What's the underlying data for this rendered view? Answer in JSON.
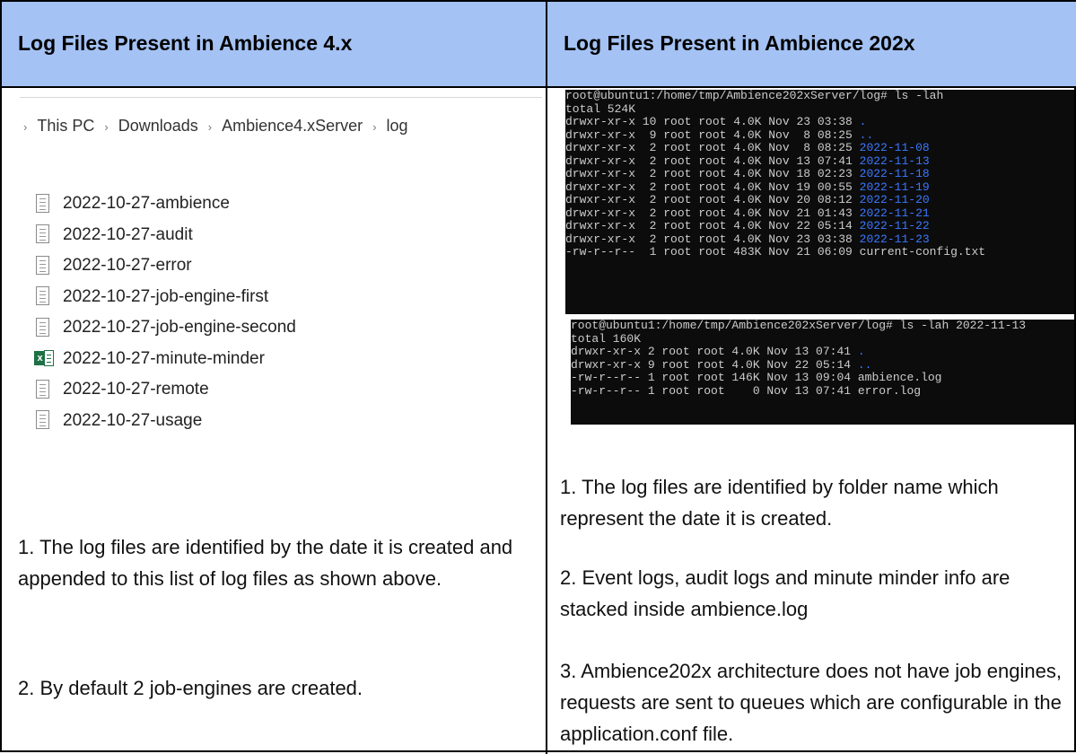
{
  "headers": {
    "left": "Log Files Present in Ambience 4.x",
    "right": "Log Files Present in Ambience 202x"
  },
  "breadcrumb": [
    "This PC",
    "Downloads",
    "Ambience4.xServer",
    "log"
  ],
  "files": [
    {
      "name": "2022-10-27-ambience",
      "icon": "text-file-icon"
    },
    {
      "name": "2022-10-27-audit",
      "icon": "text-file-icon"
    },
    {
      "name": "2022-10-27-error",
      "icon": "text-file-icon"
    },
    {
      "name": "2022-10-27-job-engine-first",
      "icon": "text-file-icon"
    },
    {
      "name": "2022-10-27-job-engine-second",
      "icon": "text-file-icon"
    },
    {
      "name": "2022-10-27-minute-minder",
      "icon": "excel-file-icon"
    },
    {
      "name": "2022-10-27-remote",
      "icon": "text-file-icon"
    },
    {
      "name": "2022-10-27-usage",
      "icon": "text-file-icon"
    }
  ],
  "left_notes": [
    "1. The log files are identified by the date it is created and appended to this list of log files as shown above.",
    "2. By default 2 job-engines are created."
  ],
  "terminal1": [
    {
      "text": "root@ubuntu1:/home/tmp/Ambience202xServer/log# ls -lah",
      "blue": ""
    },
    {
      "text": "total 524K",
      "blue": ""
    },
    {
      "text": "drwxr-xr-x 10 root root 4.0K Nov 23 03:38 ",
      "blue": "."
    },
    {
      "text": "drwxr-xr-x  9 root root 4.0K Nov  8 08:25 ",
      "blue": ".."
    },
    {
      "text": "drwxr-xr-x  2 root root 4.0K Nov  8 08:25 ",
      "blue": "2022-11-08"
    },
    {
      "text": "drwxr-xr-x  2 root root 4.0K Nov 13 07:41 ",
      "blue": "2022-11-13"
    },
    {
      "text": "drwxr-xr-x  2 root root 4.0K Nov 18 02:23 ",
      "blue": "2022-11-18"
    },
    {
      "text": "drwxr-xr-x  2 root root 4.0K Nov 19 00:55 ",
      "blue": "2022-11-19"
    },
    {
      "text": "drwxr-xr-x  2 root root 4.0K Nov 20 08:12 ",
      "blue": "2022-11-20"
    },
    {
      "text": "drwxr-xr-x  2 root root 4.0K Nov 21 01:43 ",
      "blue": "2022-11-21"
    },
    {
      "text": "drwxr-xr-x  2 root root 4.0K Nov 22 05:14 ",
      "blue": "2022-11-22"
    },
    {
      "text": "drwxr-xr-x  2 root root 4.0K Nov 23 03:38 ",
      "blue": "2022-11-23"
    },
    {
      "text": "-rw-r--r--  1 root root 483K Nov 21 06:09 current-config.txt",
      "blue": ""
    }
  ],
  "terminal2": [
    {
      "text": "root@ubuntu1:/home/tmp/Ambience202xServer/log# ls -lah 2022-11-13",
      "blue": ""
    },
    {
      "text": "total 160K",
      "blue": ""
    },
    {
      "text": "drwxr-xr-x 2 root root 4.0K Nov 13 07:41 ",
      "blue": "."
    },
    {
      "text": "drwxr-xr-x 9 root root 4.0K Nov 22 05:14 ",
      "blue": ".."
    },
    {
      "text": "-rw-r--r-- 1 root root 146K Nov 13 09:04 ambience.log",
      "blue": ""
    },
    {
      "text": "-rw-r--r-- 1 root root    0 Nov 13 07:41 error.log",
      "blue": ""
    }
  ],
  "right_notes": [
    "1. The log files are identified by folder name which represent the date it is created.",
    "2. Event logs, audit logs and minute minder info are stacked inside ambience.log",
    "3. Ambience202x architecture does not have job engines, requests are sent to queues which are configurable in the application.conf file."
  ],
  "colors": {
    "header_bg": "#a4c2f4",
    "terminal_bg": "#0c0c0c",
    "terminal_text": "#cccccc",
    "terminal_dir": "#3b78ff"
  }
}
